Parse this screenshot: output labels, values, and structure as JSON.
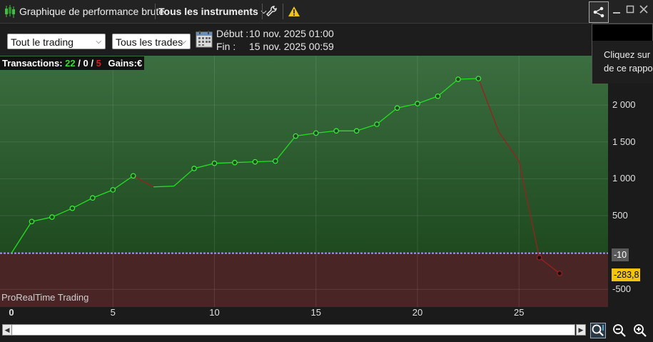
{
  "window": {
    "title": "Graphique de performance brute",
    "instrument_selector": "Tous les instruments",
    "icons": [
      "candlestick-icon",
      "wrench-icon",
      "warning-icon",
      "share-icon",
      "minimize-icon",
      "maximize-icon",
      "close-icon"
    ]
  },
  "filters": {
    "trading_scope": "Tout le trading",
    "trade_filter": "Tous les trades",
    "start_label": "Début :",
    "start_value": "10 nov. 2025 01:00",
    "end_label": "Fin :",
    "end_value": "15 nov. 2025 00:59"
  },
  "stats": {
    "transactions_label": "Transactions:",
    "wins": "22",
    "sep1": "/",
    "neutral": "0",
    "sep2": "/",
    "losses": "5",
    "gains_label": "Gains:",
    "gains_value": "€"
  },
  "popup": {
    "line1": "Cliquez sur",
    "line2": "de ce rappo"
  },
  "watermark": "ProRealTime Trading",
  "badges": {
    "zero_line": "-10",
    "last_value": "-283,8"
  },
  "colors": {
    "gain_zone": "#2f5a33",
    "loss_zone": "#4a2526",
    "gain_line": "#22e022",
    "loss_line": "#9a2020",
    "badge_last": "#f2c40f"
  },
  "chart_data": {
    "type": "line",
    "title": "",
    "xlabel": "",
    "ylabel": "",
    "x_ticks": [
      "0",
      "5",
      "10",
      "15",
      "20",
      "25"
    ],
    "y_ticks": [
      "2 000",
      "1 500",
      "1 000",
      "500",
      "-500"
    ],
    "xlim": [
      0,
      29.4
    ],
    "ylim": [
      -740,
      2670
    ],
    "grid": true,
    "x": [
      0,
      1,
      2,
      3,
      4,
      5,
      6,
      7,
      8,
      9,
      10,
      11,
      12,
      13,
      14,
      15,
      16,
      17,
      18,
      19,
      20,
      21,
      22,
      23,
      24,
      25,
      26,
      27
    ],
    "values": [
      -10,
      420,
      480,
      600,
      740,
      850,
      1040,
      890,
      900,
      1140,
      1210,
      1220,
      1230,
      1240,
      1580,
      1620,
      1650,
      1650,
      1740,
      1960,
      2020,
      2120,
      2350,
      2360,
      1640,
      1240,
      -70,
      -283.8
    ],
    "markers": [
      false,
      true,
      true,
      true,
      true,
      true,
      true,
      false,
      false,
      true,
      true,
      true,
      true,
      true,
      true,
      true,
      true,
      true,
      true,
      true,
      true,
      true,
      true,
      true,
      false,
      false,
      true,
      true
    ]
  }
}
